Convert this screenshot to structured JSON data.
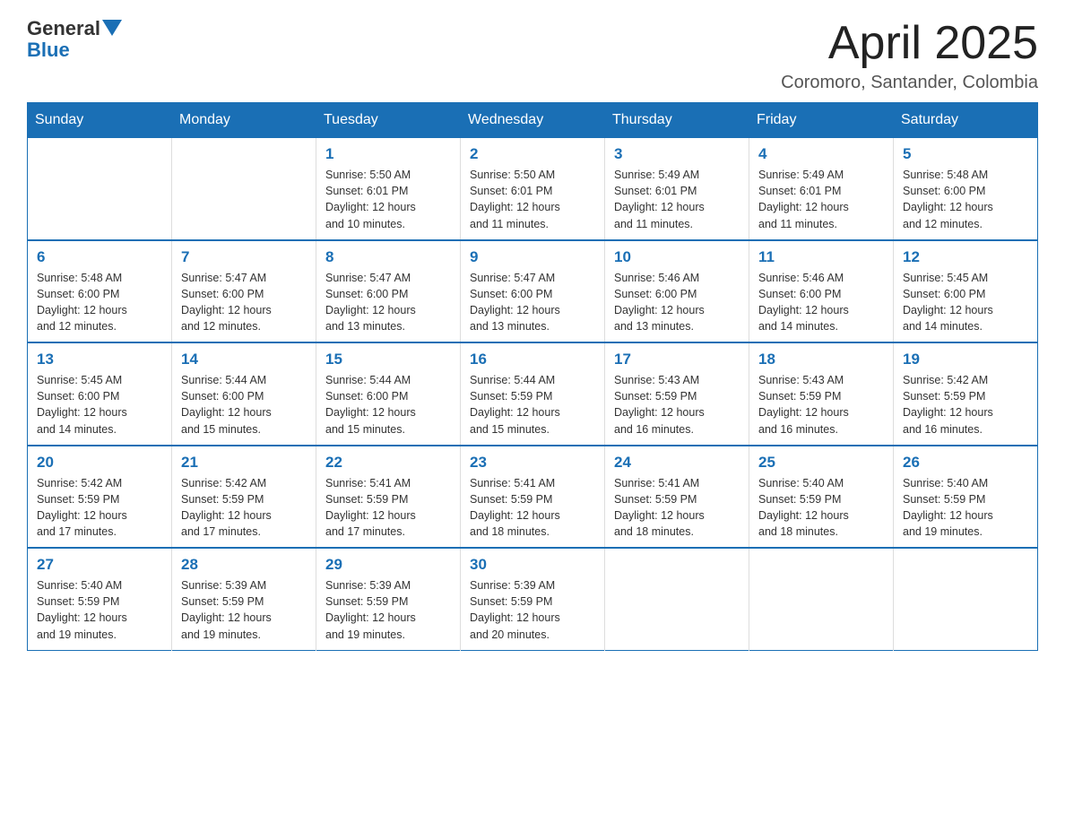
{
  "header": {
    "logo_text1": "General",
    "logo_text2": "Blue",
    "month_title": "April 2025",
    "location": "Coromoro, Santander, Colombia"
  },
  "days_of_week": [
    "Sunday",
    "Monday",
    "Tuesday",
    "Wednesday",
    "Thursday",
    "Friday",
    "Saturday"
  ],
  "weeks": [
    [
      {
        "day": "",
        "info": ""
      },
      {
        "day": "",
        "info": ""
      },
      {
        "day": "1",
        "info": "Sunrise: 5:50 AM\nSunset: 6:01 PM\nDaylight: 12 hours\nand 10 minutes."
      },
      {
        "day": "2",
        "info": "Sunrise: 5:50 AM\nSunset: 6:01 PM\nDaylight: 12 hours\nand 11 minutes."
      },
      {
        "day": "3",
        "info": "Sunrise: 5:49 AM\nSunset: 6:01 PM\nDaylight: 12 hours\nand 11 minutes."
      },
      {
        "day": "4",
        "info": "Sunrise: 5:49 AM\nSunset: 6:01 PM\nDaylight: 12 hours\nand 11 minutes."
      },
      {
        "day": "5",
        "info": "Sunrise: 5:48 AM\nSunset: 6:00 PM\nDaylight: 12 hours\nand 12 minutes."
      }
    ],
    [
      {
        "day": "6",
        "info": "Sunrise: 5:48 AM\nSunset: 6:00 PM\nDaylight: 12 hours\nand 12 minutes."
      },
      {
        "day": "7",
        "info": "Sunrise: 5:47 AM\nSunset: 6:00 PM\nDaylight: 12 hours\nand 12 minutes."
      },
      {
        "day": "8",
        "info": "Sunrise: 5:47 AM\nSunset: 6:00 PM\nDaylight: 12 hours\nand 13 minutes."
      },
      {
        "day": "9",
        "info": "Sunrise: 5:47 AM\nSunset: 6:00 PM\nDaylight: 12 hours\nand 13 minutes."
      },
      {
        "day": "10",
        "info": "Sunrise: 5:46 AM\nSunset: 6:00 PM\nDaylight: 12 hours\nand 13 minutes."
      },
      {
        "day": "11",
        "info": "Sunrise: 5:46 AM\nSunset: 6:00 PM\nDaylight: 12 hours\nand 14 minutes."
      },
      {
        "day": "12",
        "info": "Sunrise: 5:45 AM\nSunset: 6:00 PM\nDaylight: 12 hours\nand 14 minutes."
      }
    ],
    [
      {
        "day": "13",
        "info": "Sunrise: 5:45 AM\nSunset: 6:00 PM\nDaylight: 12 hours\nand 14 minutes."
      },
      {
        "day": "14",
        "info": "Sunrise: 5:44 AM\nSunset: 6:00 PM\nDaylight: 12 hours\nand 15 minutes."
      },
      {
        "day": "15",
        "info": "Sunrise: 5:44 AM\nSunset: 6:00 PM\nDaylight: 12 hours\nand 15 minutes."
      },
      {
        "day": "16",
        "info": "Sunrise: 5:44 AM\nSunset: 5:59 PM\nDaylight: 12 hours\nand 15 minutes."
      },
      {
        "day": "17",
        "info": "Sunrise: 5:43 AM\nSunset: 5:59 PM\nDaylight: 12 hours\nand 16 minutes."
      },
      {
        "day": "18",
        "info": "Sunrise: 5:43 AM\nSunset: 5:59 PM\nDaylight: 12 hours\nand 16 minutes."
      },
      {
        "day": "19",
        "info": "Sunrise: 5:42 AM\nSunset: 5:59 PM\nDaylight: 12 hours\nand 16 minutes."
      }
    ],
    [
      {
        "day": "20",
        "info": "Sunrise: 5:42 AM\nSunset: 5:59 PM\nDaylight: 12 hours\nand 17 minutes."
      },
      {
        "day": "21",
        "info": "Sunrise: 5:42 AM\nSunset: 5:59 PM\nDaylight: 12 hours\nand 17 minutes."
      },
      {
        "day": "22",
        "info": "Sunrise: 5:41 AM\nSunset: 5:59 PM\nDaylight: 12 hours\nand 17 minutes."
      },
      {
        "day": "23",
        "info": "Sunrise: 5:41 AM\nSunset: 5:59 PM\nDaylight: 12 hours\nand 18 minutes."
      },
      {
        "day": "24",
        "info": "Sunrise: 5:41 AM\nSunset: 5:59 PM\nDaylight: 12 hours\nand 18 minutes."
      },
      {
        "day": "25",
        "info": "Sunrise: 5:40 AM\nSunset: 5:59 PM\nDaylight: 12 hours\nand 18 minutes."
      },
      {
        "day": "26",
        "info": "Sunrise: 5:40 AM\nSunset: 5:59 PM\nDaylight: 12 hours\nand 19 minutes."
      }
    ],
    [
      {
        "day": "27",
        "info": "Sunrise: 5:40 AM\nSunset: 5:59 PM\nDaylight: 12 hours\nand 19 minutes."
      },
      {
        "day": "28",
        "info": "Sunrise: 5:39 AM\nSunset: 5:59 PM\nDaylight: 12 hours\nand 19 minutes."
      },
      {
        "day": "29",
        "info": "Sunrise: 5:39 AM\nSunset: 5:59 PM\nDaylight: 12 hours\nand 19 minutes."
      },
      {
        "day": "30",
        "info": "Sunrise: 5:39 AM\nSunset: 5:59 PM\nDaylight: 12 hours\nand 20 minutes."
      },
      {
        "day": "",
        "info": ""
      },
      {
        "day": "",
        "info": ""
      },
      {
        "day": "",
        "info": ""
      }
    ]
  ]
}
